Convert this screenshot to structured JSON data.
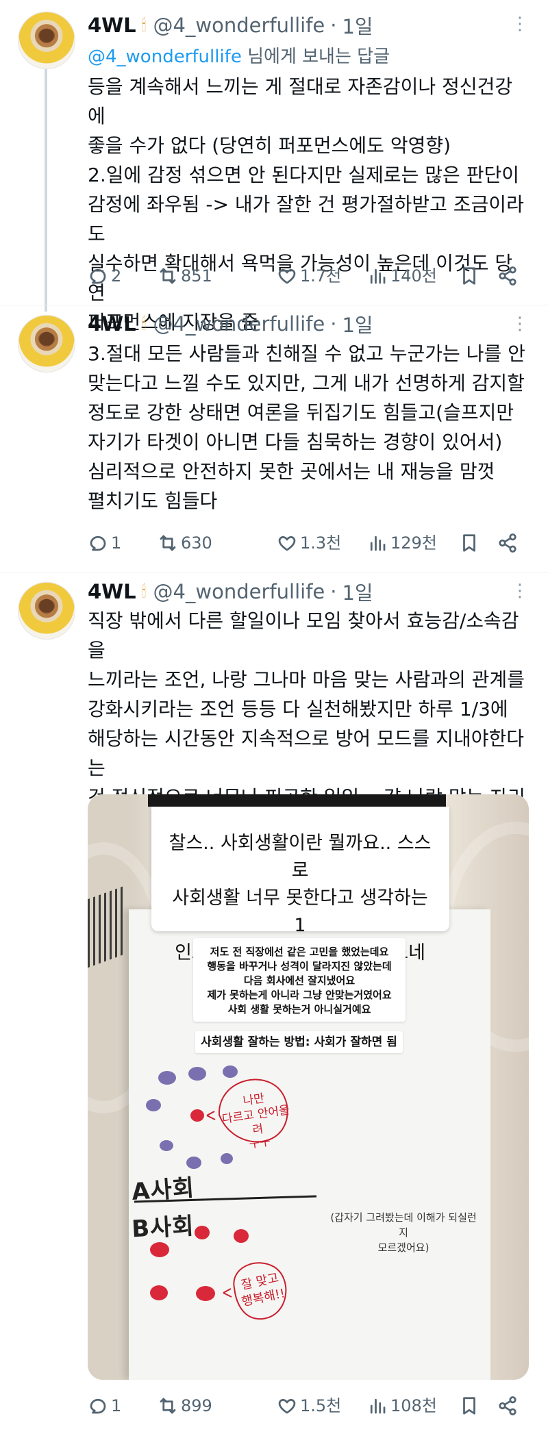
{
  "tweets": [
    {
      "display_name": "4WL",
      "name_emoji": "🕯",
      "handle": "@4_wonderfullife",
      "separator": "·",
      "time": "1일",
      "reply_to_handle": "@4_wonderfullife",
      "reply_to_suffix": " 님에게 보내는 답글",
      "body": "등을 계속해서 느끼는 게 절대로 자존감이나 정신건강에\n좋을 수가 없다 (당연히 퍼포먼스에도 악영향)\n2.일에 감정 섞으면 안 된다지만 실제로는 많은 판단이\n감정에 좌우됨 -> 내가 잘한 건 평가절하받고 조금이라도\n실수하면 확대해서 욕먹을 가능성이 높은데 이것도 당연\n퍼포먼스에 지장을 줌",
      "metrics": {
        "replies": "2",
        "reposts": "851",
        "likes": "1.7천",
        "views": "140천"
      }
    },
    {
      "display_name": "4WL",
      "name_emoji": "🕯",
      "handle": "@4_wonderfullife",
      "separator": "·",
      "time": "1일",
      "body": "3.절대 모든 사람들과 친해질 수 없고 누군가는 나를 안\n맞는다고 느낄 수도 있지만, 그게 내가 선명하게 감지할\n정도로 강한 상태면 여론을 뒤집기도 힘들고(슬프지만\n자기가 타겟이 아니면 다들 침묵하는 경향이 있어서)\n심리적으로 안전하지 못한 곳에서는 내 재능을 맘껏\n펼치기도 힘들다",
      "metrics": {
        "replies": "1",
        "reposts": "630",
        "likes": "1.3천",
        "views": "129천"
      }
    },
    {
      "display_name": "4WL",
      "name_emoji": "🕯",
      "handle": "@4_wonderfullife",
      "separator": "·",
      "time": "1일",
      "body": "직장 밖에서 다른 할일이나 모임 찾아서 효능감/소속감을\n느끼라는 조언, 나랑 그나마 마음 맞는 사람과의 관계를\n강화시키라는 조언 등등 다 실천해봤지만 하루 1/3에\n해당하는 시간동안 지속적으로 방어 모드를 지내야한다는\n건 정신적으로 너무나 피곤한 일임... 걍 나랑 맞는 자리를\n찾자",
      "metrics": {
        "replies": "1",
        "reposts": "899",
        "likes": "1.5천",
        "views": "108천"
      },
      "media": {
        "speech_text": "찰스.. 사회생활이란 뭘까요.. 스스로\n사회생활 너무 못한다고 생각하는1\n인으로써.. 직장생활 너무 힘드네여",
        "reply_note": "저도 전 직장에선 같은 고민을 했었는데요\n행동을 바꾸거나 성격이 달라지진 않았는데\n다음 회사에선 잘지냈어요\n제가 못하는게 아니라 그냥 안맞는거였어요\n사회 생활 못하는거 아니실거예요",
        "method_text": "사회생활 잘하는 방법: 사회가 잘하면 됨",
        "label_a": "A사회",
        "label_b": "B사회",
        "red_note_top": "나만\n다르고 안어울려\nㅜㅜ",
        "side_note": "(갑자기 그려봤는데 이해가 되실런지\n모르겠어요)",
        "red_note_bottom": "잘 맞고\n행복해!!",
        "colors": {
          "purple_dot": "#6d62a8",
          "red_dot": "#d8283a",
          "red_ink": "#c91f2d"
        }
      }
    }
  ],
  "icons": [
    "reply-icon",
    "repost-icon",
    "like-icon",
    "views-icon",
    "bookmark-icon",
    "share-icon",
    "more-icon"
  ],
  "colors": {
    "text": "#0f1419",
    "secondary": "#536471",
    "link": "#1d9bf0",
    "thread_line": "#cfd9de"
  }
}
